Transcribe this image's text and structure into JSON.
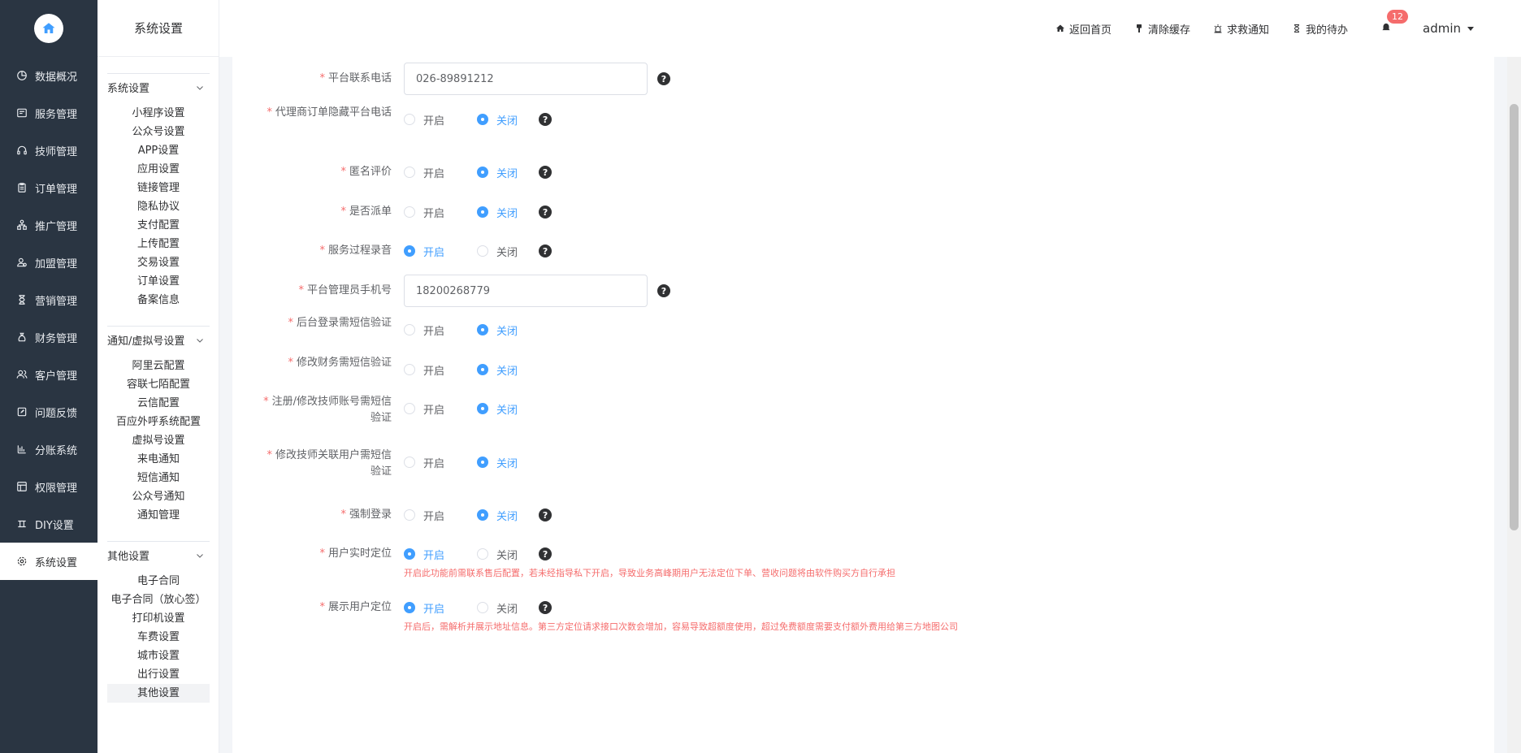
{
  "nav": {
    "items": [
      {
        "label": "数据概况",
        "icon": "pie-chart-icon"
      },
      {
        "label": "服务管理",
        "icon": "service-icon"
      },
      {
        "label": "技师管理",
        "icon": "headset-icon"
      },
      {
        "label": "订单管理",
        "icon": "clipboard-icon"
      },
      {
        "label": "推广管理",
        "icon": "share-icon"
      },
      {
        "label": "加盟管理",
        "icon": "user-group-icon"
      },
      {
        "label": "营销管理",
        "icon": "hourglass-icon"
      },
      {
        "label": "财务管理",
        "icon": "money-bag-icon"
      },
      {
        "label": "客户管理",
        "icon": "users-icon"
      },
      {
        "label": "问题反馈",
        "icon": "edit-icon"
      },
      {
        "label": "分账系统",
        "icon": "bar-chart-icon"
      },
      {
        "label": "权限管理",
        "icon": "form-icon"
      },
      {
        "label": "DIY设置",
        "icon": "diy-icon"
      },
      {
        "label": "系统设置",
        "icon": "gear-icon",
        "active": true
      }
    ]
  },
  "sub": {
    "title": "系统设置",
    "groups": [
      {
        "title": "系统设置",
        "items": [
          "小程序设置",
          "公众号设置",
          "APP设置",
          "应用设置",
          "链接管理",
          "隐私协议",
          "支付配置",
          "上传配置",
          "交易设置",
          "订单设置",
          "备案信息"
        ]
      },
      {
        "title": "通知/虚拟号设置",
        "items": [
          "阿里云配置",
          "容联七陌配置",
          "云信配置",
          "百应外呼系统配置",
          "虚拟号设置",
          "来电通知",
          "短信通知",
          "公众号通知",
          "通知管理"
        ]
      },
      {
        "title": "其他设置",
        "items": [
          "电子合同",
          "电子合同（放心签）",
          "打印机设置",
          "车费设置",
          "城市设置",
          "出行设置",
          "其他设置"
        ],
        "active_index": 6
      }
    ]
  },
  "header": {
    "links": [
      {
        "label": "返回首页",
        "icon": "home-icon"
      },
      {
        "label": "清除缓存",
        "icon": "brush-icon"
      },
      {
        "label": "求救通知",
        "icon": "alarm-icon"
      },
      {
        "label": "我的待办",
        "icon": "hourglass-icon"
      }
    ],
    "badge": "12",
    "user": "admin"
  },
  "form": {
    "on_label": "开启",
    "off_label": "关闭",
    "help_glyph": "?",
    "required_mark": "*",
    "rows": [
      {
        "label": "平台联系电话",
        "type": "input",
        "value": "026-89891212",
        "help": true
      },
      {
        "label": "代理商订单隐藏平台电话",
        "type": "radio",
        "selected": "off",
        "help": true
      },
      {
        "label": "匿名评价",
        "type": "radio",
        "selected": "off",
        "help": true
      },
      {
        "label": "是否派单",
        "type": "radio",
        "selected": "off",
        "help": true
      },
      {
        "label": "服务过程录音",
        "type": "radio",
        "selected": "on",
        "help": true
      },
      {
        "label": "平台管理员手机号",
        "type": "input",
        "value": "18200268779",
        "help": true
      },
      {
        "label": "后台登录需短信验证",
        "type": "radio",
        "selected": "off",
        "help": false
      },
      {
        "label": "修改财务需短信验证",
        "type": "radio",
        "selected": "off",
        "help": false
      },
      {
        "label": "注册/修改技师账号需短信验证",
        "type": "radio",
        "selected": "off",
        "help": false
      },
      {
        "label": "修改技师关联用户需短信验证",
        "type": "radio",
        "selected": "off",
        "help": false
      },
      {
        "label": "强制登录",
        "type": "radio",
        "selected": "off",
        "help": true
      },
      {
        "label": "用户实时定位",
        "type": "radio",
        "selected": "on",
        "help": true,
        "tip": "开启此功能前需联系售后配置，若未经指导私下开启，导致业务高峰期用户无法定位下单、营收问题将由软件购买方自行承担"
      },
      {
        "label": "展示用户定位",
        "type": "radio",
        "selected": "on",
        "help": true,
        "tip": "开启后，需解析并展示地址信息。第三方定位请求接口次数会增加，容易导致超额度使用，超过免费额度需要支付额外费用给第三方地图公司"
      }
    ]
  }
}
